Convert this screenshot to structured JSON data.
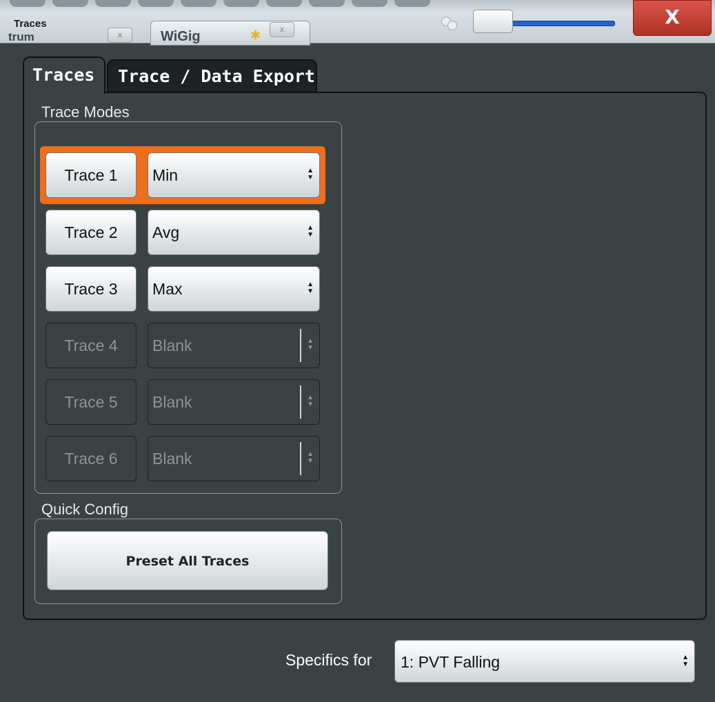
{
  "window": {
    "title": "Traces",
    "app_tab_fragment": "trum",
    "app_tab_name": "WiGig",
    "mini_close_glyph": "x",
    "close_glyph": "X"
  },
  "tabs": [
    {
      "label": "Traces",
      "active": true
    },
    {
      "label": "Trace / Data Export",
      "active": false
    }
  ],
  "trace_modes": {
    "label": "Trace Modes",
    "rows": [
      {
        "trace": "Trace 1",
        "mode": "Min",
        "enabled": true,
        "selected": true
      },
      {
        "trace": "Trace 2",
        "mode": "Avg",
        "enabled": true,
        "selected": false
      },
      {
        "trace": "Trace 3",
        "mode": "Max",
        "enabled": true,
        "selected": false
      },
      {
        "trace": "Trace 4",
        "mode": "Blank",
        "enabled": false,
        "selected": false
      },
      {
        "trace": "Trace 5",
        "mode": "Blank",
        "enabled": false,
        "selected": false
      },
      {
        "trace": "Trace 6",
        "mode": "Blank",
        "enabled": false,
        "selected": false
      }
    ]
  },
  "quick_config": {
    "label": "Quick Config",
    "preset_button": "Preset All Traces"
  },
  "specifics": {
    "label": "Specifics for",
    "value": "1: PVT Falling"
  },
  "colors": {
    "background": "#3a4244",
    "highlight": "#ef6e1c",
    "close_button": "#c0392b"
  }
}
